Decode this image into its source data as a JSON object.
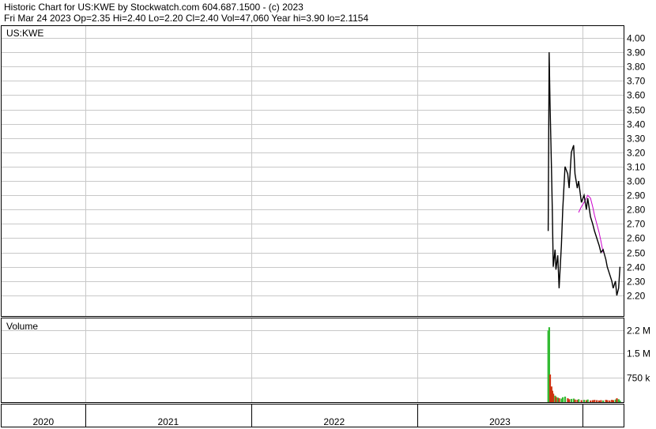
{
  "header": {
    "title_line": "Historic Chart for US:KWE by Stockwatch.com 604.687.1500 - (c) 2023",
    "quote_line": "Fri Mar 24 2023  Op=2.35  Hi=2.40  Lo=2.20  Cl=2.40  Vol=47,060  Year hi=3.90  lo=2.1154"
  },
  "chart_data": [
    {
      "type": "line",
      "title": "US:KWE",
      "ylim": [
        2.1,
        4.0
      ],
      "y_ticks": [
        "4.00",
        "3.90",
        "3.80",
        "3.70",
        "3.60",
        "3.50",
        "3.40",
        "3.30",
        "3.20",
        "3.10",
        "3.00",
        "2.90",
        "2.80",
        "2.70",
        "2.60",
        "2.50",
        "2.40",
        "2.30",
        "2.20"
      ],
      "x_ticks": [
        "2020",
        "2021",
        "2022",
        "2023"
      ],
      "grid": true,
      "colors": {
        "price": "#000000",
        "moving_average": "#cc00cc"
      },
      "series": [
        {
          "x": [
            "2022-10-17",
            "2022-10-19",
            "2022-10-21",
            "2022-10-24",
            "2022-10-26",
            "2022-10-28",
            "2022-11-01",
            "2022-11-03",
            "2022-11-07",
            "2022-11-10",
            "2022-11-15",
            "2022-11-18",
            "2022-11-23",
            "2022-11-29",
            "2022-12-02",
            "2022-12-07",
            "2022-12-12",
            "2022-12-15",
            "2022-12-20",
            "2022-12-23",
            "2022-12-29",
            "2023-01-04",
            "2023-01-09",
            "2023-01-12",
            "2023-01-18",
            "2023-01-23",
            "2023-01-27",
            "2023-02-01",
            "2023-02-06",
            "2023-02-10",
            "2023-02-15",
            "2023-02-21",
            "2023-02-24",
            "2023-03-01",
            "2023-03-06",
            "2023-03-09",
            "2023-03-14",
            "2023-03-17",
            "2023-03-21",
            "2023-03-24"
          ],
          "values": [
            2.65,
            3.9,
            3.55,
            3.1,
            2.8,
            2.4,
            2.52,
            2.38,
            2.48,
            2.25,
            2.55,
            2.8,
            3.1,
            3.05,
            2.95,
            3.2,
            3.25,
            3.05,
            2.95,
            3.0,
            2.85,
            2.9,
            2.8,
            2.88,
            2.75,
            2.7,
            2.65,
            2.6,
            2.55,
            2.5,
            2.52,
            2.45,
            2.4,
            2.35,
            2.3,
            2.25,
            2.3,
            2.2,
            2.25,
            2.4
          ]
        },
        {
          "x": [
            "2022-12-23",
            "2022-12-29",
            "2023-01-04",
            "2023-01-09",
            "2023-01-12",
            "2023-01-18",
            "2023-01-23",
            "2023-01-27",
            "2023-02-01",
            "2023-02-06",
            "2023-02-10",
            "2023-02-15"
          ],
          "values": [
            2.78,
            2.82,
            2.85,
            2.88,
            2.9,
            2.88,
            2.82,
            2.76,
            2.7,
            2.64,
            2.58,
            2.5
          ]
        }
      ]
    },
    {
      "type": "bar",
      "title": "Volume",
      "ylabel": "",
      "ylim": [
        0,
        2500000
      ],
      "y_ticks": [
        "2.2 M",
        "1.5 M",
        "750 k"
      ],
      "colors": {
        "up": "#33bb33",
        "down": "#cc3311"
      },
      "categories": [
        "2022-10-17",
        "2022-10-19",
        "2022-10-21",
        "2022-10-24",
        "2022-10-26",
        "2022-10-28",
        "2022-11-01",
        "2022-11-03",
        "2022-11-07",
        "2022-11-10",
        "2022-11-15",
        "2022-11-18",
        "2022-11-23",
        "2022-11-29",
        "2022-12-02",
        "2022-12-07",
        "2022-12-12",
        "2022-12-15",
        "2022-12-20",
        "2022-12-23",
        "2022-12-29",
        "2023-01-04",
        "2023-01-09",
        "2023-01-12",
        "2023-01-18",
        "2023-01-23",
        "2023-01-27",
        "2023-02-01",
        "2023-02-06",
        "2023-02-10",
        "2023-02-15",
        "2023-02-21",
        "2023-02-24",
        "2023-03-01",
        "2023-03-06",
        "2023-03-09",
        "2023-03-14",
        "2023-03-17",
        "2023-03-21",
        "2023-03-24"
      ],
      "values": [
        2200000,
        2300000,
        850000,
        480000,
        350000,
        260000,
        200000,
        160000,
        140000,
        120000,
        110000,
        150000,
        170000,
        120000,
        90000,
        100000,
        110000,
        80000,
        70000,
        90000,
        60000,
        70000,
        60000,
        80000,
        50000,
        60000,
        70000,
        60000,
        50000,
        60000,
        50000,
        70000,
        60000,
        50000,
        70000,
        60000,
        80000,
        120000,
        90000,
        47060
      ],
      "direction": [
        "up",
        "up",
        "down",
        "down",
        "down",
        "down",
        "up",
        "down",
        "up",
        "down",
        "up",
        "up",
        "up",
        "down",
        "down",
        "up",
        "up",
        "down",
        "down",
        "up",
        "down",
        "up",
        "down",
        "up",
        "down",
        "down",
        "down",
        "down",
        "down",
        "down",
        "up",
        "down",
        "down",
        "down",
        "down",
        "down",
        "up",
        "down",
        "up",
        "up"
      ]
    }
  ]
}
